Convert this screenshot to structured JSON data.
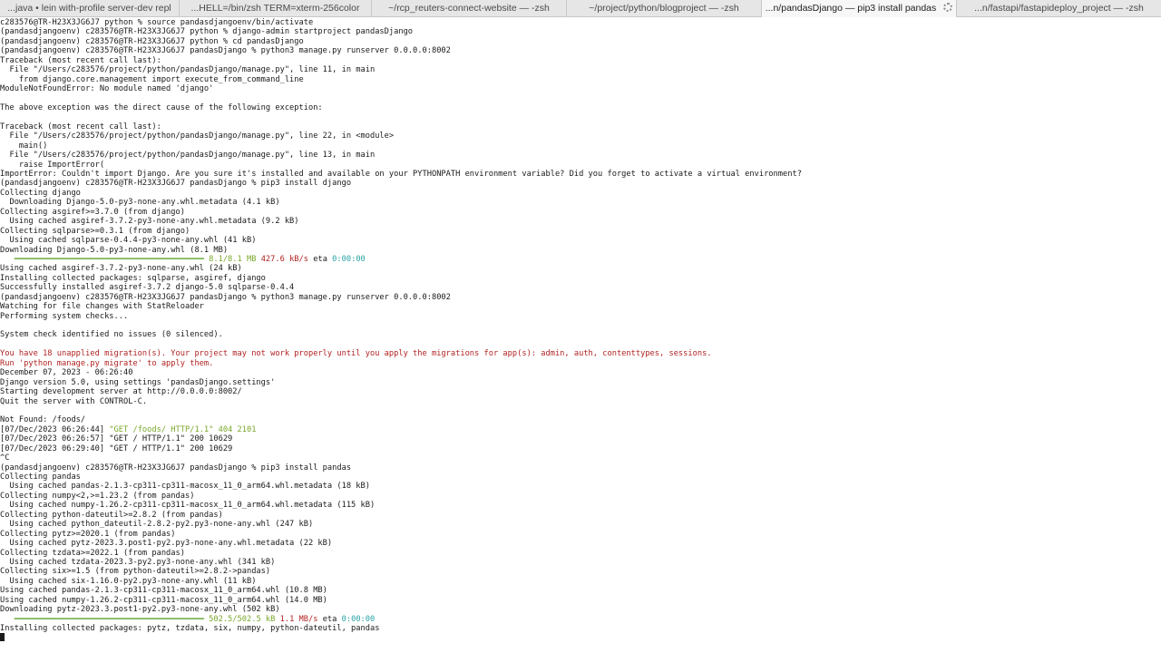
{
  "tabs": [
    {
      "label": "...java • lein with-profile server-dev repl",
      "active": false
    },
    {
      "label": "...HELL=/bin/zsh TERM=xterm-256color",
      "active": false
    },
    {
      "label": "~/rcp_reuters-connect-website — -zsh",
      "active": false
    },
    {
      "label": "~/project/python/blogproject — -zsh",
      "active": false
    },
    {
      "label": "...n/pandasDjango — pip3 install pandas",
      "active": true
    },
    {
      "label": "...n/fastapi/fastapideploy_project — -zsh",
      "active": false
    }
  ],
  "colors": {
    "error": "#b22222",
    "success_green": "#7aa82a",
    "eta_cyan": "#2aa2a6",
    "progress_bar": "#6aa73a"
  },
  "terminal": {
    "lines": [
      "c283576@TR-H23X3JG6J7 python % source pandasdjangoenv/bin/activate",
      "(pandasdjangoenv) c283576@TR-H23X3JG6J7 python % django-admin startproject pandasDjango",
      "(pandasdjangoenv) c283576@TR-H23X3JG6J7 python % cd pandasDjango",
      "(pandasdjangoenv) c283576@TR-H23X3JG6J7 pandasDjango % python3 manage.py runserver 0.0.0.0:8002",
      "Traceback (most recent call last):",
      "  File \"/Users/c283576/project/python/pandasDjango/manage.py\", line 11, in main",
      "    from django.core.management import execute_from_command_line",
      "ModuleNotFoundError: No module named 'django'",
      "",
      "The above exception was the direct cause of the following exception:",
      "",
      "Traceback (most recent call last):",
      "  File \"/Users/c283576/project/python/pandasDjango/manage.py\", line 22, in <module>",
      "    main()",
      "  File \"/Users/c283576/project/python/pandasDjango/manage.py\", line 13, in main",
      "    raise ImportError(",
      "ImportError: Couldn't import Django. Are you sure it's installed and available on your PYTHONPATH environment variable? Did you forget to activate a virtual environment?",
      "(pandasdjangoenv) c283576@TR-H23X3JG6J7 pandasDjango % pip3 install django",
      "Collecting django",
      "  Downloading Django-5.0-py3-none-any.whl.metadata (4.1 kB)",
      "Collecting asgiref>=3.7.0 (from django)",
      "  Using cached asgiref-3.7.2-py3-none-any.whl.metadata (9.2 kB)",
      "Collecting sqlparse>=0.3.1 (from django)",
      "  Using cached sqlparse-0.4.4-py3-none-any.whl (41 kB)",
      "Downloading Django-5.0-py3-none-any.whl (8.1 MB)"
    ],
    "progress1": {
      "bar": "   ━━━━━━━━━━━━━━━━━━━━━━━━━━━━━━━━━━━━━━━━ ",
      "size": "8.1/8.1 MB",
      "speed": "427.6 kB/s",
      "eta_label": "eta",
      "eta": "0:00:00"
    },
    "lines2": [
      "Using cached asgiref-3.7.2-py3-none-any.whl (24 kB)",
      "Installing collected packages: sqlparse, asgiref, django",
      "Successfully installed asgiref-3.7.2 django-5.0 sqlparse-0.4.4",
      "(pandasdjangoenv) c283576@TR-H23X3JG6J7 pandasDjango % python3 manage.py runserver 0.0.0.0:8002",
      "Watching for file changes with StatReloader",
      "Performing system checks...",
      "",
      "System check identified no issues (0 silenced).",
      ""
    ],
    "warn1": "You have 18 unapplied migration(s). Your project may not work properly until you apply the migrations for app(s): admin, auth, contenttypes, sessions.",
    "warn2": "Run 'python manage.py migrate' to apply them.",
    "lines3": [
      "December 07, 2023 - 06:26:40",
      "Django version 5.0, using settings 'pandasDjango.settings'",
      "Starting development server at http://0.0.0.0:8002/",
      "Quit the server with CONTROL-C.",
      "",
      "Not Found: /foods/"
    ],
    "log404_prefix": "[07/Dec/2023 06:26:44] ",
    "log404_msg": "\"GET /foods/ HTTP/1.1\" 404 2101",
    "lines4": [
      "[07/Dec/2023 06:26:57] \"GET / HTTP/1.1\" 200 10629",
      "[07/Dec/2023 06:29:40] \"GET / HTTP/1.1\" 200 10629",
      "^C",
      "(pandasdjangoenv) c283576@TR-H23X3JG6J7 pandasDjango % pip3 install pandas",
      "Collecting pandas",
      "  Using cached pandas-2.1.3-cp311-cp311-macosx_11_0_arm64.whl.metadata (18 kB)",
      "Collecting numpy<2,>=1.23.2 (from pandas)",
      "  Using cached numpy-1.26.2-cp311-cp311-macosx_11_0_arm64.whl.metadata (115 kB)",
      "Collecting python-dateutil>=2.8.2 (from pandas)",
      "  Using cached python_dateutil-2.8.2-py2.py3-none-any.whl (247 kB)",
      "Collecting pytz>=2020.1 (from pandas)",
      "  Using cached pytz-2023.3.post1-py2.py3-none-any.whl.metadata (22 kB)",
      "Collecting tzdata>=2022.1 (from pandas)",
      "  Using cached tzdata-2023.3-py2.py3-none-any.whl (341 kB)",
      "Collecting six>=1.5 (from python-dateutil>=2.8.2->pandas)",
      "  Using cached six-1.16.0-py2.py3-none-any.whl (11 kB)",
      "Using cached pandas-2.1.3-cp311-cp311-macosx_11_0_arm64.whl (10.8 MB)",
      "Using cached numpy-1.26.2-cp311-cp311-macosx_11_0_arm64.whl (14.0 MB)",
      "Downloading pytz-2023.3.post1-py2.py3-none-any.whl (502 kB)"
    ],
    "progress2": {
      "bar": "   ━━━━━━━━━━━━━━━━━━━━━━━━━━━━━━━━━━━━━━━━ ",
      "size": "502.5/502.5 kB",
      "speed": "1.1 MB/s",
      "eta_label": "eta",
      "eta": "0:00:00"
    },
    "last_line": "Installing collected packages: pytz, tzdata, six, numpy, python-dateutil, pandas"
  }
}
